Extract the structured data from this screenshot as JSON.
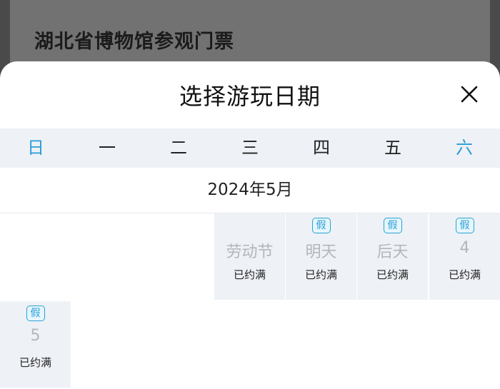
{
  "background": {
    "title": "湖北省博物馆参观门票"
  },
  "sheet": {
    "title": "选择游玩日期",
    "close_icon": "close-icon"
  },
  "weekdays": [
    "日",
    "一",
    "二",
    "三",
    "四",
    "五",
    "六"
  ],
  "month_title": "2024年5月",
  "days": [
    {
      "label": "劳动节",
      "status": "已约满",
      "holiday_badge": ""
    },
    {
      "label": "明天",
      "status": "已约满",
      "holiday_badge": "假"
    },
    {
      "label": "后天",
      "status": "已约满",
      "holiday_badge": "假"
    },
    {
      "label": "4",
      "status": "已约满",
      "holiday_badge": "假"
    },
    {
      "label": "5",
      "status": "已约满",
      "holiday_badge": "假"
    }
  ],
  "colors": {
    "accent": "#2a9ed8",
    "weekday_bar": "#eef1f6",
    "disabled_day_text": "#b3b6bc",
    "overlay": "#4a4a4a"
  }
}
